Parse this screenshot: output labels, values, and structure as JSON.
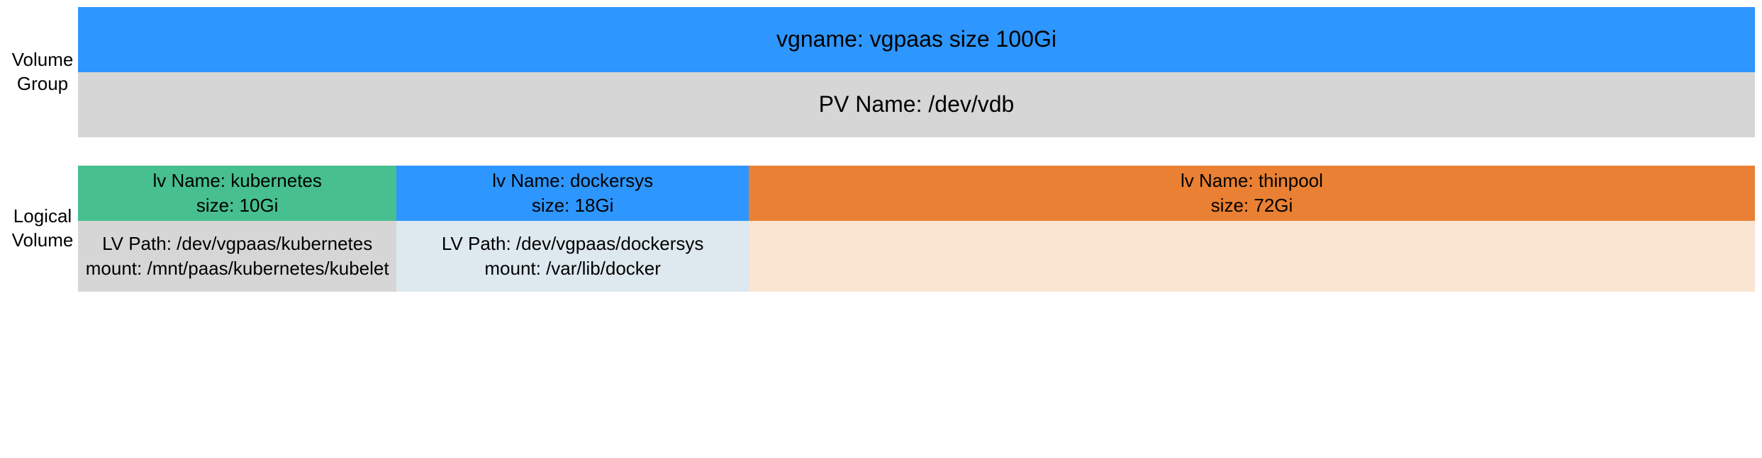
{
  "labels": {
    "volume_group_line1": "Volume",
    "volume_group_line2": "Group",
    "logical_volume_line1": "Logical",
    "logical_volume_line2": "Volume"
  },
  "volume_group": {
    "header": "vgname: vgpaas size 100Gi",
    "pv_name": "PV Name: /dev/vdb"
  },
  "logical_volumes": [
    {
      "name_line": "lv Name: kubernetes",
      "size_line": "size: 10Gi",
      "path_line": "LV Path: /dev/vgpaas/kubernetes",
      "mount_line": "mount: /mnt/paas/kubernetes/kubelet",
      "width_pct": 19,
      "header_color": "green",
      "mount_color": "gray"
    },
    {
      "name_line": "lv Name: dockersys",
      "size_line": "size: 18Gi",
      "path_line": "LV Path: /dev/vgpaas/dockersys",
      "mount_line": "mount: /var/lib/docker",
      "width_pct": 21,
      "header_color": "blue",
      "mount_color": "ltblue"
    },
    {
      "name_line": "lv Name: thinpool",
      "size_line": "size: 72Gi",
      "path_line": "",
      "mount_line": "",
      "width_pct": 60,
      "header_color": "orange",
      "mount_color": "peach"
    }
  ]
}
